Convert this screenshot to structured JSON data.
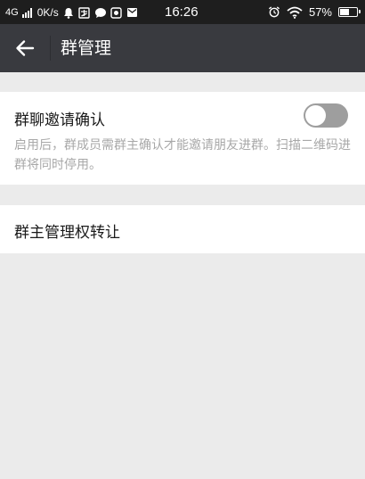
{
  "status_bar": {
    "network": "4G",
    "speed": "0K/s",
    "time": "16:26",
    "battery": "57%",
    "battery_level": 0.57,
    "icons": [
      "signal-icon",
      "notification-bell-icon",
      "app-notification-icon",
      "chat-icon",
      "gallery-icon",
      "mail-icon",
      "alarm-icon",
      "wifi-icon",
      "battery-icon"
    ]
  },
  "app_bar": {
    "title": "群管理",
    "back_icon": "arrow-left-icon"
  },
  "settings": {
    "invite_confirm": {
      "label": "群聊邀请确认",
      "description": "启用后，群成员需群主确认才能邀请朋友进群。扫描二维码进群将同时停用。",
      "enabled": false
    },
    "transfer_owner": {
      "label": "群主管理权转让"
    }
  },
  "colors": {
    "status_bar": "#1e1e1e",
    "app_bar": "#393a3f",
    "background": "#ebebeb",
    "toggle_off": "#9e9e9e"
  }
}
